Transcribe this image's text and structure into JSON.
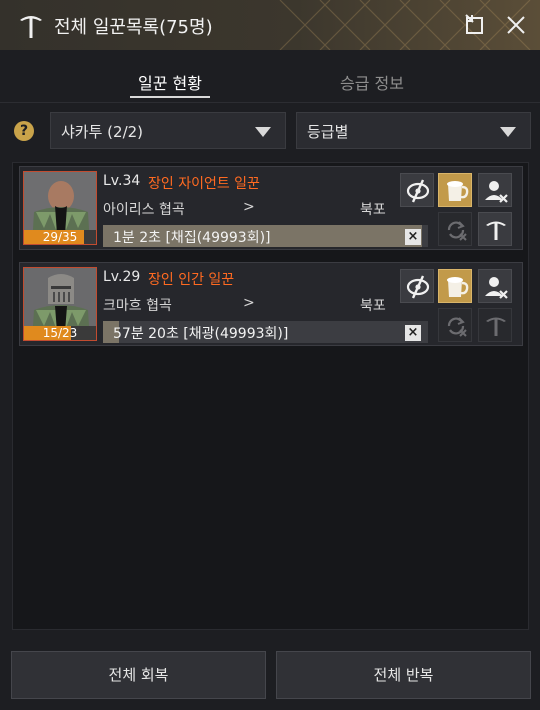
{
  "window": {
    "title": "전체 일꾼목록(75명)",
    "icon": "pickaxe-icon"
  },
  "titlebar_buttons": [
    {
      "icon": "popout-icon"
    },
    {
      "icon": "close-icon"
    }
  ],
  "tabs": [
    {
      "label": "일꾼 현황",
      "active": true
    },
    {
      "label": "승급 정보",
      "active": false
    }
  ],
  "help": {
    "label": "?"
  },
  "filters": {
    "town": {
      "value": "샤카투 (2/2)"
    },
    "sort": {
      "value": "등급별"
    }
  },
  "workers": [
    {
      "level": "Lv.34",
      "name": "장인 자이언트 일꾼",
      "stamina": "29/35",
      "stamina_fraction": 0.83,
      "from": "아이리스 협곡",
      "arrow": ">",
      "to": "북포",
      "task": "1분 2초 [채집(49993회)]",
      "task_progress": 0.98,
      "cancel": "×"
    },
    {
      "level": "Lv.29",
      "name": "장인 인간 일꾼",
      "stamina": "15/23",
      "stamina_fraction": 0.65,
      "from": "크마흐 협곡",
      "arrow": ">",
      "to": "북포",
      "task": "57분 20초 [채광(49993회)]",
      "task_progress": 0.05,
      "cancel": "×"
    }
  ],
  "bottom": {
    "recover_all": "전체 회복",
    "repeat_all": "전체 반복"
  },
  "colors": {
    "accent": "#ff6a21",
    "gold": "#c29a4a",
    "stamina": "#e08a1e"
  }
}
